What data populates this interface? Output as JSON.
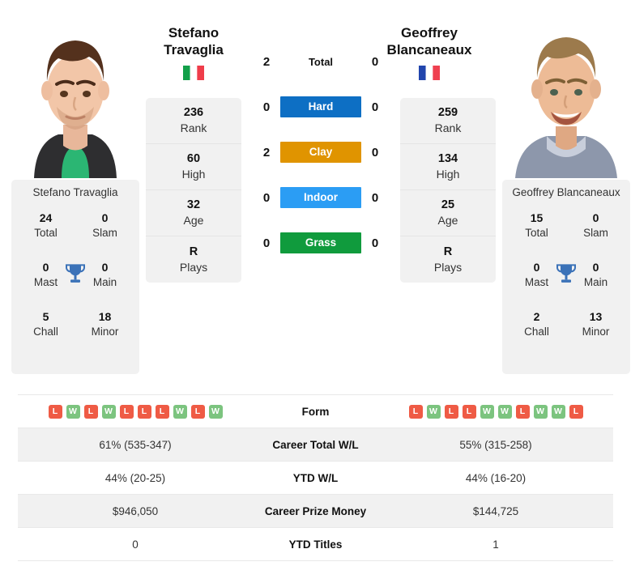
{
  "players": {
    "left": {
      "first_name": "Stefano",
      "last_name": "Travaglia",
      "full_name": "Stefano Travaglia",
      "country": "Italy",
      "flag_icon": "flag-italy-icon",
      "rank": "236",
      "rank_label": "Rank",
      "high": "60",
      "high_label": "High",
      "age": "32",
      "age_label": "Age",
      "plays": "R",
      "plays_label": "Plays",
      "titles": {
        "total": "24",
        "total_label": "Total",
        "slam": "0",
        "slam_label": "Slam",
        "mast": "0",
        "mast_label": "Mast",
        "main": "0",
        "main_label": "Main",
        "chall": "5",
        "chall_label": "Chall",
        "minor": "18",
        "minor_label": "Minor"
      },
      "form": [
        "L",
        "W",
        "L",
        "W",
        "L",
        "L",
        "L",
        "W",
        "L",
        "W"
      ],
      "career_total_wl": "61% (535-347)",
      "ytd_wl": "44% (20-25)",
      "career_prize_money": "$946,050",
      "ytd_titles": "0"
    },
    "right": {
      "first_name": "Geoffrey",
      "last_name": "Blancaneaux",
      "full_name": "Geoffrey Blancaneaux",
      "country": "France",
      "flag_icon": "flag-france-icon",
      "rank": "259",
      "rank_label": "Rank",
      "high": "134",
      "high_label": "High",
      "age": "25",
      "age_label": "Age",
      "plays": "R",
      "plays_label": "Plays",
      "titles": {
        "total": "15",
        "total_label": "Total",
        "slam": "0",
        "slam_label": "Slam",
        "mast": "0",
        "mast_label": "Mast",
        "main": "0",
        "main_label": "Main",
        "chall": "2",
        "chall_label": "Chall",
        "minor": "13",
        "minor_label": "Minor"
      },
      "form": [
        "L",
        "W",
        "L",
        "L",
        "W",
        "W",
        "L",
        "W",
        "W",
        "L"
      ],
      "career_total_wl": "55% (315-258)",
      "ytd_wl": "44% (16-20)",
      "career_prize_money": "$144,725",
      "ytd_titles": "1"
    }
  },
  "head_to_head": [
    {
      "label": "Total",
      "left": "2",
      "right": "0",
      "style": "plain",
      "color": ""
    },
    {
      "label": "Hard",
      "left": "0",
      "right": "0",
      "style": "badge",
      "color": "#0d6fc4"
    },
    {
      "label": "Clay",
      "left": "2",
      "right": "0",
      "style": "badge",
      "color": "#e09400"
    },
    {
      "label": "Indoor",
      "left": "0",
      "right": "0",
      "style": "badge",
      "color": "#2b9df4"
    },
    {
      "label": "Grass",
      "left": "0",
      "right": "0",
      "style": "badge",
      "color": "#109b3d"
    }
  ],
  "stats_table": {
    "rows": [
      {
        "label": "Form",
        "type": "form"
      },
      {
        "label": "Career Total W/L",
        "type": "text",
        "left": "61% (535-347)",
        "right": "55% (315-258)"
      },
      {
        "label": "YTD W/L",
        "type": "text",
        "left": "44% (20-25)",
        "right": "44% (16-20)"
      },
      {
        "label": "Career Prize Money",
        "type": "text",
        "left": "$946,050",
        "right": "$144,725"
      },
      {
        "label": "YTD Titles",
        "type": "text",
        "left": "0",
        "right": "1"
      }
    ]
  },
  "colors": {
    "win_badge": "#7cc47f",
    "loss_badge": "#ef5b45",
    "card_bg": "#f1f1f1",
    "trophy": "#3b72b8"
  }
}
